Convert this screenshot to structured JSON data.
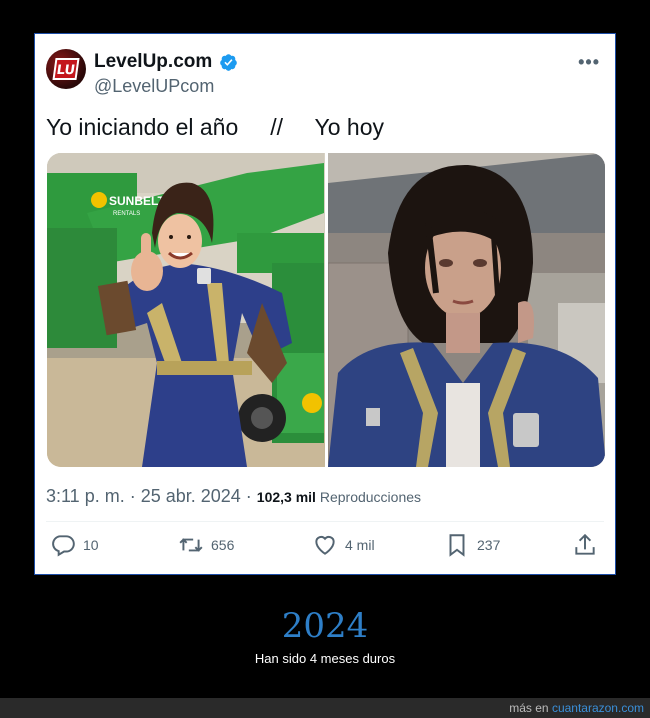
{
  "tweet": {
    "account_name": "LevelUp.com",
    "handle": "@LevelUPcom",
    "avatar_text": "LU",
    "text": "Yo iniciando el año     //     Yo hoy",
    "time": "3:11 p. m. · 25 abr. 2024 · ",
    "views_count": "102,3 mil",
    "views_label": " Reproducciones",
    "photo_sign_text": "SUNBELT",
    "photo_sign_sub": "RENTALS",
    "photos": [
      {
        "description_name": "photo-left"
      },
      {
        "description_name": "photo-right"
      }
    ],
    "actions": {
      "replies": "10",
      "retweets": "656",
      "likes": "4 mil",
      "bookmarks": "237"
    }
  },
  "caption": {
    "title": "2024",
    "subtitle": "Han sido 4 meses duros"
  },
  "footer": {
    "prefix": "más en ",
    "link": "cuantarazon.com"
  },
  "colors": {
    "verified": "#1d9bf0",
    "title": "#2e7fc8",
    "link": "#3a8fd8",
    "frame_border": "#1d4ea8"
  }
}
